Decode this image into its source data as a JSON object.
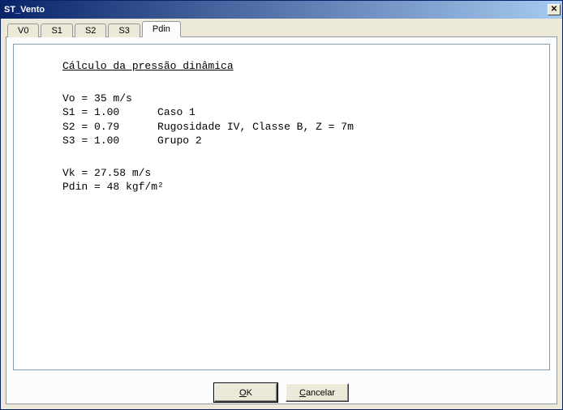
{
  "window": {
    "title": "ST_Vento",
    "close_glyph": "✕"
  },
  "tabs": [
    {
      "label": "V0"
    },
    {
      "label": "S1"
    },
    {
      "label": "S2"
    },
    {
      "label": "S3"
    },
    {
      "label": "Pdin"
    }
  ],
  "active_tab_index": 4,
  "content": {
    "heading": "Cálculo da pressão dinâmica",
    "params": {
      "vo_label": "Vo = ",
      "vo_value": "35 m/s",
      "s1_label": "S1 = ",
      "s1_value": "1.00",
      "s1_note": "Caso 1",
      "s2_label": "S2 = ",
      "s2_value": "0.79",
      "s2_note": "Rugosidade IV, Classe B, Z = 7m",
      "s3_label": "S3 = ",
      "s3_value": "1.00",
      "s3_note": "Grupo 2"
    },
    "results": {
      "vk_label": "Vk = ",
      "vk_value": "27.58 m/s",
      "pdin_label": "Pdin = ",
      "pdin_value": "48 kgf/m²"
    }
  },
  "buttons": {
    "ok_prefix": "O",
    "ok_rest": "K",
    "cancel_prefix": "C",
    "cancel_rest": "ancelar"
  }
}
